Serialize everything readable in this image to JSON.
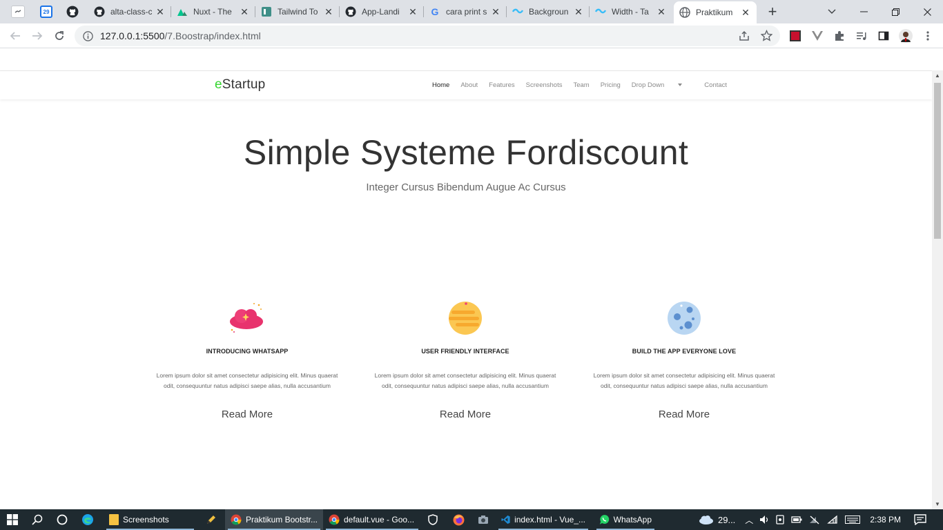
{
  "browser": {
    "tabs": [
      {
        "title": ""
      },
      {
        "title": ""
      },
      {
        "title": ""
      },
      {
        "title": "alta-class-c"
      },
      {
        "title": "Nuxt - The"
      },
      {
        "title": "Tailwind To"
      },
      {
        "title": "App-Landi"
      },
      {
        "title": "cara print s"
      },
      {
        "title": "Backgroun"
      },
      {
        "title": "Width - Ta"
      },
      {
        "title": "Praktikum"
      }
    ],
    "new_tab": "+",
    "url_host": "127.0.0.1:5500",
    "url_path": "/7.Boostrap/index.html"
  },
  "site": {
    "brand_first": "e",
    "brand_rest": "Startup",
    "nav": [
      "Home",
      "About",
      "Features",
      "Screenshots",
      "Team",
      "Pricing",
      "Drop Down",
      "Contact"
    ],
    "hero_title": "Simple Systeme Fordiscount",
    "hero_subtitle": "Integer Cursus Bibendum Augue Ac Cursus",
    "features": [
      {
        "icon": "cloud-icon",
        "title": "INTRODUCING WHATSAPP",
        "text": "Lorem ipsum dolor sit amet consectetur adipisicing elit. Minus quaerat odit, consequuntur natus adipisci saepe alias, nulla accusantium",
        "link": "Read More"
      },
      {
        "icon": "planet-icon",
        "title": "USER FRIENDLY INTERFACE",
        "text": "Lorem ipsum dolor sit amet consectetur adipisicing elit. Minus quaerat odit, consequuntur natus adipisci saepe alias, nulla accusantium",
        "link": "Read More"
      },
      {
        "icon": "moon-icon",
        "title": "BUILD THE APP EVERYONE LOVE",
        "text": "Lorem ipsum dolor sit amet consectetur adipisicing elit. Minus quaerat odit, consequuntur natus adipisci saepe alias, nulla accusantium",
        "link": "Read More"
      }
    ]
  },
  "taskbar": {
    "apps": [
      "Screenshots",
      "Praktikum Bootstr...",
      "default.vue - Goo...",
      "index.html - Vue_...",
      "WhatsApp"
    ],
    "weather": "29...",
    "time": "2:38 PM"
  },
  "colors": {
    "brand_accent": "#35d630",
    "taskbar_bg": "#1f2a30"
  }
}
